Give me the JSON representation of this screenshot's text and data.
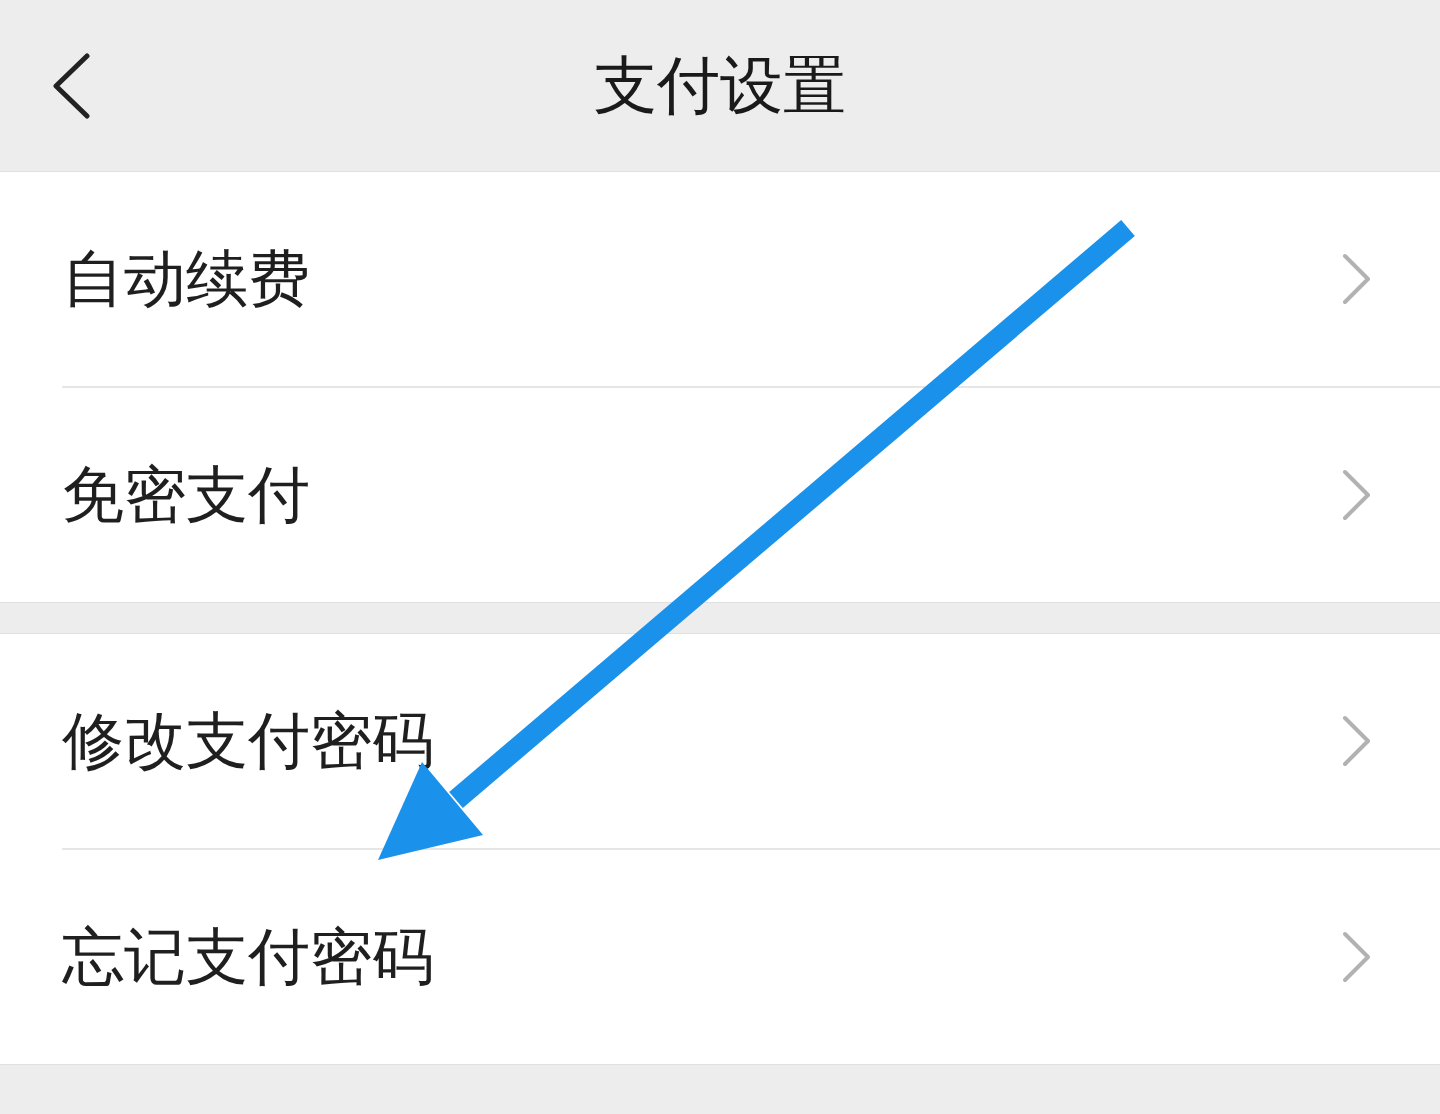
{
  "header": {
    "title": "支付设置"
  },
  "groups": [
    {
      "items": [
        {
          "label": "自动续费"
        },
        {
          "label": "免密支付"
        }
      ]
    },
    {
      "items": [
        {
          "label": "修改支付密码"
        },
        {
          "label": "忘记支付密码"
        }
      ]
    }
  ]
}
